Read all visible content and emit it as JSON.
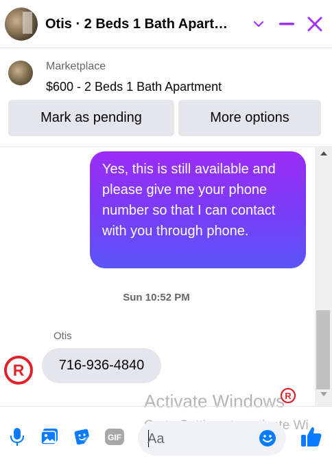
{
  "header": {
    "title": "Otis · 2 Beds 1 Bath Apart…",
    "chevron_icon": "chevron-down-icon",
    "minimize_icon": "minimize-icon",
    "close_icon": "close-icon",
    "accent_color": "#a033ff"
  },
  "marketplace": {
    "label": "Marketplace",
    "listing": "$600 - 2 Beds 1 Bath Apartment"
  },
  "actions": {
    "pending_label": "Mark as pending",
    "more_label": "More options"
  },
  "messages": {
    "outgoing": "Yes, this is still available and please give me your phone number so that I can contact with you through phone.",
    "timestamp": "Sun 10:52 PM",
    "sender": "Otis",
    "incoming": "716-936-4840"
  },
  "composer": {
    "placeholder": "Aa",
    "icons": [
      "microphone-icon",
      "photo-icon",
      "sticker-icon",
      "gif-icon",
      "emoji-icon",
      "like-icon"
    ],
    "gif_label": "GIF"
  },
  "watermark": {
    "line1": "Activate Windows",
    "line2": "Go to Settings to activate Wi"
  },
  "colors": {
    "brand_blue": "#0a7cff",
    "bubble_top": "#9b2cf6",
    "bubble_bottom": "#5a55f8",
    "avatar_red": "#e4202a"
  }
}
